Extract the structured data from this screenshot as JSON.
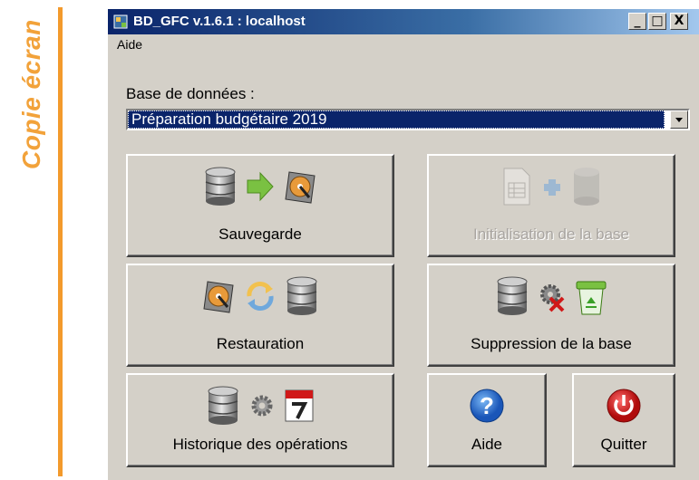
{
  "side_label": "Copie écran",
  "window": {
    "title": "BD_GFC v.1.6.1 : localhost",
    "controls": {
      "minimize": "_",
      "maximize": "□",
      "close": "X"
    }
  },
  "menu": {
    "items": [
      "Aide"
    ]
  },
  "database": {
    "label": "Base de données :",
    "selected": "Préparation budgétaire 2019"
  },
  "buttons": {
    "sauvegarde": {
      "label": "Sauvegarde",
      "enabled": true,
      "icons": [
        "database-icon",
        "arrow-right-icon",
        "hard-drive-icon"
      ]
    },
    "initialisation": {
      "label": "Initialisation de la base",
      "enabled": false,
      "icons": [
        "document-icon",
        "plus-icon",
        "database-icon"
      ]
    },
    "restauration": {
      "label": "Restauration",
      "enabled": true,
      "icons": [
        "hard-drive-icon",
        "refresh-icon",
        "database-icon"
      ]
    },
    "suppression": {
      "label": "Suppression de la base",
      "enabled": true,
      "icons": [
        "database-icon",
        "gear-delete-icon",
        "recycle-bin-icon"
      ]
    },
    "historique": {
      "label": "Historique des opérations",
      "enabled": true,
      "icons": [
        "database-icon",
        "gear-icon",
        "calendar-icon"
      ]
    },
    "aide": {
      "label": "Aide",
      "enabled": true,
      "icons": [
        "help-icon"
      ]
    },
    "quitter": {
      "label": "Quitter",
      "enabled": true,
      "icons": [
        "power-icon"
      ]
    }
  },
  "colors": {
    "accent_orange": "#f39a2c",
    "title_bar": "#0a246a",
    "window_bg": "#d4d0c8"
  }
}
